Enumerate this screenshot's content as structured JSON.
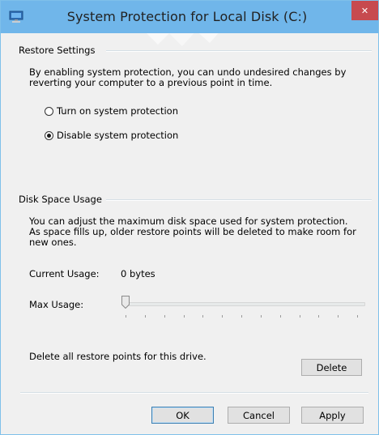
{
  "window": {
    "title": "System Protection for Local Disk (C:)",
    "close_glyph": "✕"
  },
  "restore": {
    "heading": "Restore Settings",
    "description": "By enabling system protection, you can undo undesired changes by reverting your computer to a previous point in time.",
    "options": [
      {
        "label": "Turn on system protection",
        "selected": false
      },
      {
        "label": "Disable system protection",
        "selected": true
      }
    ]
  },
  "disk": {
    "heading": "Disk Space Usage",
    "description": "You can adjust the maximum disk space used for system protection. As space fills up, older restore points will be deleted to make room for new ones.",
    "current_label": "Current Usage:",
    "current_value": "0 bytes",
    "max_label": "Max Usage:",
    "max_usage_fraction": 0
  },
  "delete": {
    "text": "Delete all restore points for this drive.",
    "button": "Delete"
  },
  "buttons": {
    "ok": "OK",
    "cancel": "Cancel",
    "apply": "Apply"
  },
  "colors": {
    "titlebar": "#70b6ea",
    "close": "#c74a4f",
    "client": "#f0f0f0"
  }
}
